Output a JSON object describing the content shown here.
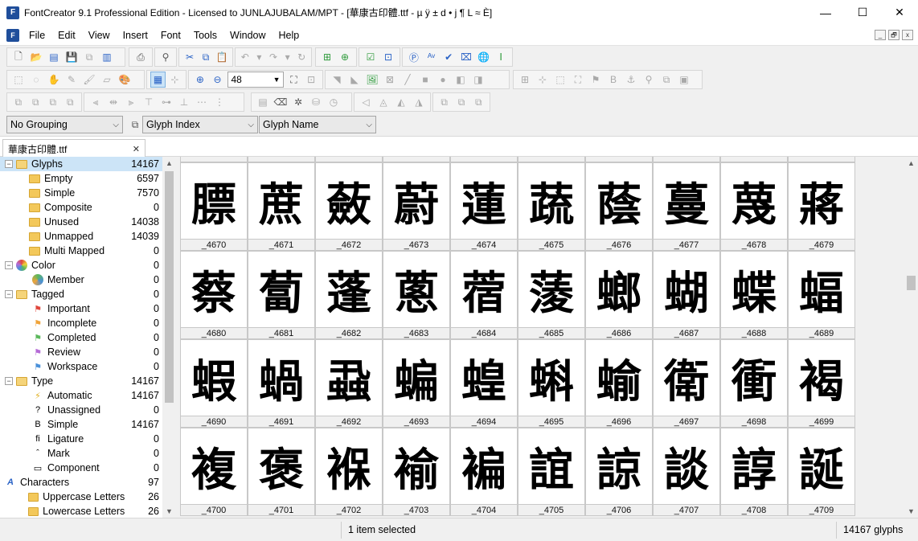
{
  "window": {
    "title": "FontCreator 9.1 Professional Edition - Licensed to JUNLAJUBALAM/MPT - [華康古印體.ttf -  µ ÿ ± d • j ¶ L ≈ È]",
    "app_icon": "F",
    "minimize": "—",
    "maximize": "☐",
    "close": "✕"
  },
  "menu": {
    "items": [
      "File",
      "Edit",
      "View",
      "Insert",
      "Font",
      "Tools",
      "Window",
      "Help"
    ],
    "mdi": [
      "_",
      "🗗",
      "x"
    ]
  },
  "toolbar": {
    "zoom_value": "48"
  },
  "grouping": {
    "group_by": "No Grouping",
    "sort_primary": "Glyph Index",
    "sort_secondary": "Glyph Name"
  },
  "document_tab": {
    "label": "華康古印體.ttf",
    "close": "✕"
  },
  "tree": [
    {
      "label": "Glyphs",
      "count": "14167",
      "level": 0,
      "expander": "−",
      "kind": "folder-open",
      "selected": true
    },
    {
      "label": "Empty",
      "count": "6597",
      "level": 1,
      "kind": "folder"
    },
    {
      "label": "Simple",
      "count": "7570",
      "level": 1,
      "kind": "folder"
    },
    {
      "label": "Composite",
      "count": "0",
      "level": 1,
      "kind": "folder"
    },
    {
      "label": "Unused",
      "count": "14038",
      "level": 1,
      "kind": "folder"
    },
    {
      "label": "Unmapped",
      "count": "14039",
      "level": 1,
      "kind": "folder"
    },
    {
      "label": "Multi Mapped",
      "count": "0",
      "level": 1,
      "kind": "folder"
    },
    {
      "label": "Color",
      "count": "0",
      "level": 0,
      "expander": "−",
      "kind": "color-wheel"
    },
    {
      "label": "Member",
      "count": "0",
      "level": 2,
      "kind": "color-ball"
    },
    {
      "label": "Tagged",
      "count": "0",
      "level": 0,
      "expander": "−",
      "kind": "folder-open"
    },
    {
      "label": "Important",
      "count": "0",
      "level": 2,
      "kind": "flag-red"
    },
    {
      "label": "Incomplete",
      "count": "0",
      "level": 2,
      "kind": "flag-orange"
    },
    {
      "label": "Completed",
      "count": "0",
      "level": 2,
      "kind": "flag-green"
    },
    {
      "label": "Review",
      "count": "0",
      "level": 2,
      "kind": "flag-purple"
    },
    {
      "label": "Workspace",
      "count": "0",
      "level": 2,
      "kind": "flag-blue"
    },
    {
      "label": "Type",
      "count": "14167",
      "level": 0,
      "expander": "−",
      "kind": "folder-open"
    },
    {
      "label": "Automatic",
      "count": "14167",
      "level": 2,
      "kind": "bolt",
      "glyph": "⚡"
    },
    {
      "label": "Unassigned",
      "count": "0",
      "level": 2,
      "kind": "text",
      "glyph": "?"
    },
    {
      "label": "Simple",
      "count": "14167",
      "level": 2,
      "kind": "text",
      "glyph": "B"
    },
    {
      "label": "Ligature",
      "count": "0",
      "level": 2,
      "kind": "text",
      "glyph": "fi"
    },
    {
      "label": "Mark",
      "count": "0",
      "level": 2,
      "kind": "text",
      "glyph": "ˆ"
    },
    {
      "label": "Component",
      "count": "0",
      "level": 2,
      "kind": "text",
      "glyph": "▭"
    },
    {
      "label": "Characters",
      "count": "97",
      "level": 0,
      "kind": "letter-a"
    },
    {
      "label": "Uppercase Letters",
      "count": "26",
      "level": 1,
      "kind": "folder"
    },
    {
      "label": "Lowercase Letters",
      "count": "26",
      "level": 1,
      "kind": "folder"
    }
  ],
  "glyph_rows": [
    {
      "names": [
        "_4670",
        "_4671",
        "_4672",
        "_4673",
        "_4674",
        "_4675",
        "_4676",
        "_4677",
        "_4678",
        "_4679"
      ],
      "chars": [
        "膘",
        "蔗",
        "蘞",
        "蔚",
        "蓮",
        "蔬",
        "蔭",
        "蔓",
        "蔑",
        "蔣"
      ]
    },
    {
      "names": [
        "_4680",
        "_4681",
        "_4682",
        "_4683",
        "_4684",
        "_4685",
        "_4686",
        "_4687",
        "_4688",
        "_4689"
      ],
      "chars": [
        "蔡",
        "蔔",
        "蓬",
        "蔥",
        "蓿",
        "蔆",
        "螂",
        "蝴",
        "蝶",
        "蝠"
      ]
    },
    {
      "names": [
        "_4690",
        "_4691",
        "_4692",
        "_4693",
        "_4694",
        "_4695",
        "_4696",
        "_4697",
        "_4698",
        "_4699"
      ],
      "chars": [
        "蝦",
        "蝸",
        "蝨",
        "蝙",
        "蝗",
        "蝌",
        "蝓",
        "衛",
        "衝",
        "褐"
      ]
    },
    {
      "names": [
        "_4700",
        "_4701",
        "_4702",
        "_4703",
        "_4704",
        "_4705",
        "_4706",
        "_4707",
        "_4708",
        "_4709"
      ],
      "chars": [
        "複",
        "褒",
        "褓",
        "褕",
        "褊",
        "誼",
        "諒",
        "談",
        "諄",
        "誕"
      ]
    }
  ],
  "status": {
    "selection": "1 item selected",
    "glyph_count": "14167 glyphs"
  }
}
